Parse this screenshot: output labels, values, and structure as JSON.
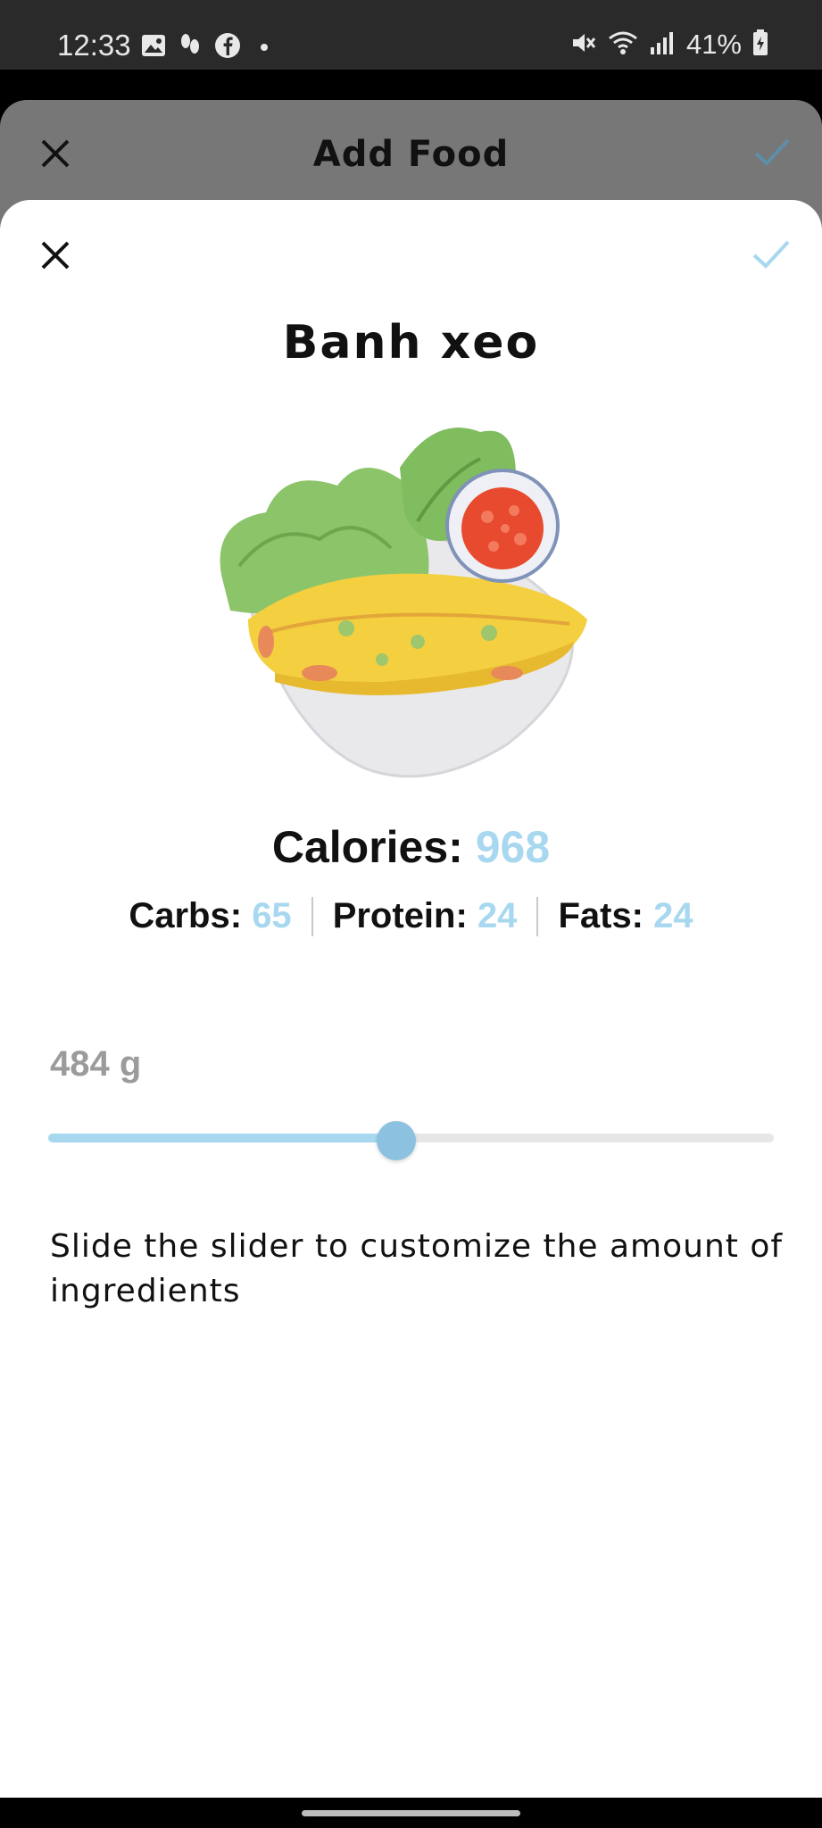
{
  "status_bar": {
    "time": "12:33",
    "battery": "41%",
    "left_icons": [
      "gallery-icon",
      "footsteps-icon",
      "facebook-icon",
      "dot-icon"
    ],
    "right_icons": [
      "mute-icon",
      "wifi-icon",
      "signal-icon",
      "battery-icon"
    ]
  },
  "background_sheet": {
    "title": "Add Food"
  },
  "modal": {
    "food_name": "Banh xeo",
    "calories_label": "Calories:",
    "calories_value": "968",
    "macros": {
      "carbs_label": "Carbs:",
      "carbs_value": "65",
      "protein_label": "Protein:",
      "protein_value": "24",
      "fats_label": "Fats:",
      "fats_value": "24"
    },
    "weight_label": "484 g",
    "slider_fraction": 0.48,
    "hint": "Slide the slider to customize the amount of ingredients"
  },
  "colors": {
    "accent": "#a8d8ef",
    "slider_thumb": "#8cc2df",
    "muted_text": "#9b9b9b"
  }
}
